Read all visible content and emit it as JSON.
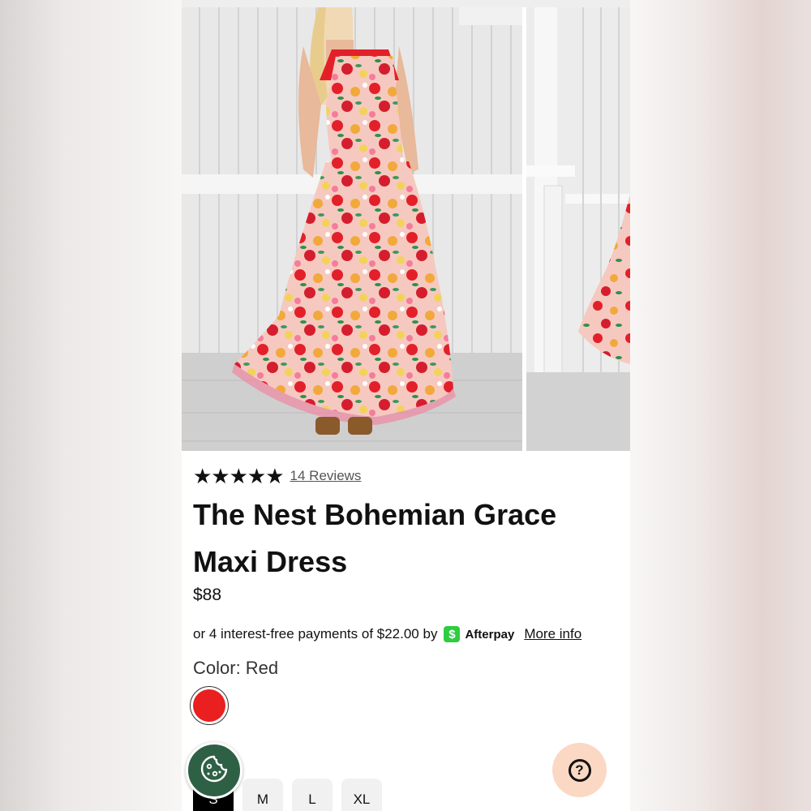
{
  "product": {
    "rating_stars": "★★★★★",
    "reviews_label": "14 Reviews",
    "title": "The Nest Bohemian Grace Maxi Dress",
    "price": "$88"
  },
  "afterpay": {
    "text": "or 4 interest-free payments of $22.00 by",
    "badge_symbol": "$",
    "brand": "Afterpay",
    "more_info": "More info",
    "badge_color": "#2ecc40"
  },
  "color": {
    "label": "Color: Red",
    "selected_swatch": "#ea1f1f"
  },
  "size": {
    "label_partial": "S",
    "options": [
      "S",
      "M",
      "L",
      "XL"
    ],
    "selected": "S"
  },
  "floating": {
    "cookie_icon": "cookie-icon",
    "help_icon": "help-icon",
    "help_symbol": "?",
    "cookie_button_color": "#2e6046",
    "help_button_color": "#fbd8c4"
  }
}
